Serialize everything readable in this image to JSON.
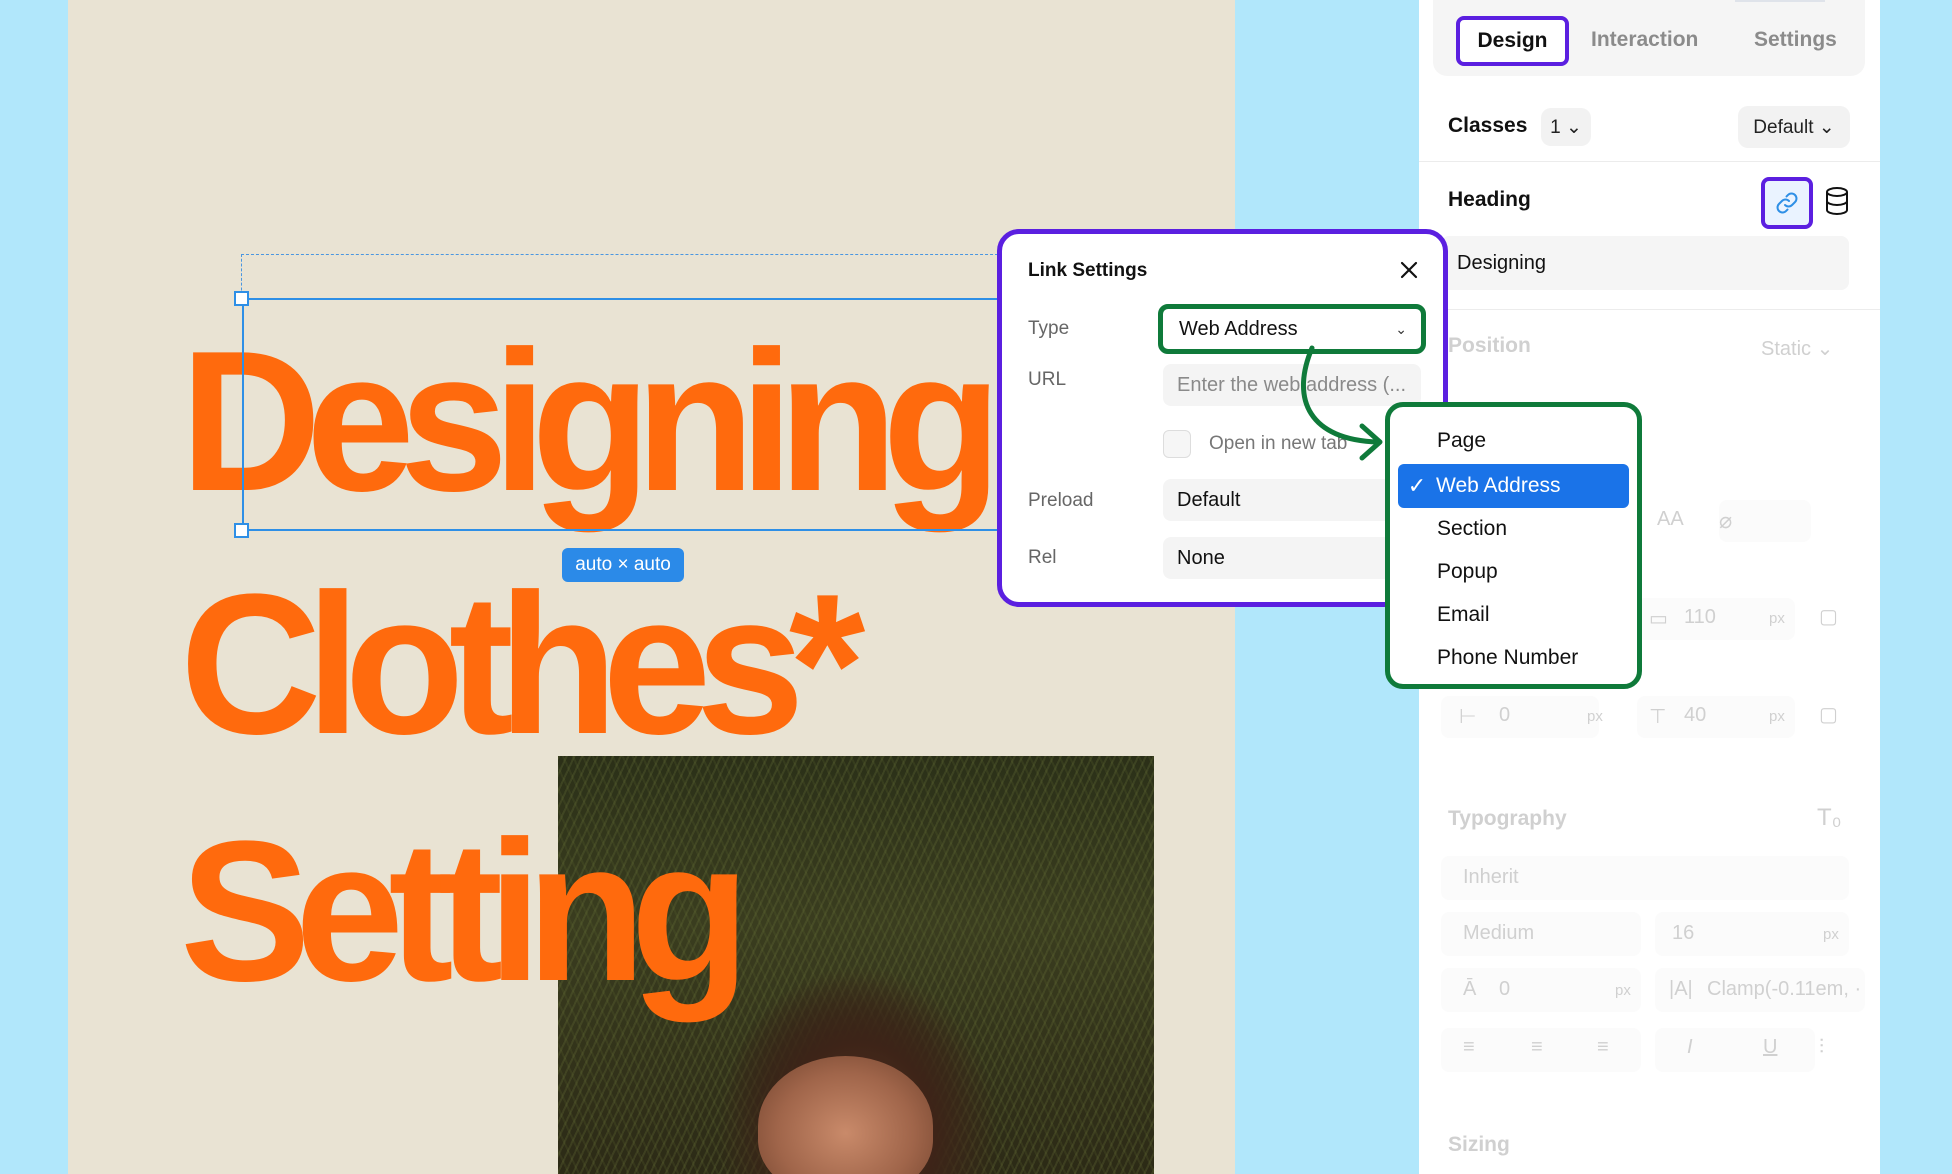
{
  "canvas": {
    "hero_lines": [
      "Designing",
      "Clothes*",
      "Setting"
    ],
    "size_badge": "auto × auto"
  },
  "panel": {
    "tabs": {
      "design": "Design",
      "interaction": "Interaction",
      "settings": "Settings"
    },
    "classes": {
      "label": "Classes",
      "count": "1 ⌄",
      "variant": "Default ⌄"
    },
    "heading": {
      "label": "Heading",
      "value": "Designing"
    },
    "position": {
      "label": "Position",
      "value": "Static ⌄"
    },
    "spacing": {
      "width": "110",
      "unit": "px",
      "left": "0",
      "top": "40"
    },
    "typography": {
      "label": "Typography",
      "font": "Inherit",
      "weight": "Medium",
      "size": "16",
      "unit": "px",
      "line_height": "0",
      "letter_spacing": "Clamp(-0.11em, ·",
      "aa_label": "AA"
    },
    "sizing": {
      "label": "Sizing"
    }
  },
  "link_settings": {
    "title": "Link Settings",
    "type_label": "Type",
    "type_value": "Web Address",
    "url_label": "URL",
    "url_placeholder": "Enter the web address (...",
    "open_new_tab": "Open in new tab",
    "preload_label": "Preload",
    "preload_value": "Default",
    "rel_label": "Rel",
    "rel_value": "None"
  },
  "type_menu": {
    "items": [
      "Page",
      "Web Address",
      "Section",
      "Popup",
      "Email",
      "Phone Number"
    ],
    "selected": "Web Address"
  },
  "colors": {
    "accent_purple": "#5b1fe0",
    "accent_green": "#0f7a3a",
    "hero_orange": "#ff6a0d",
    "selection_blue": "#2e8fe6",
    "background": "#b1e7fb"
  }
}
